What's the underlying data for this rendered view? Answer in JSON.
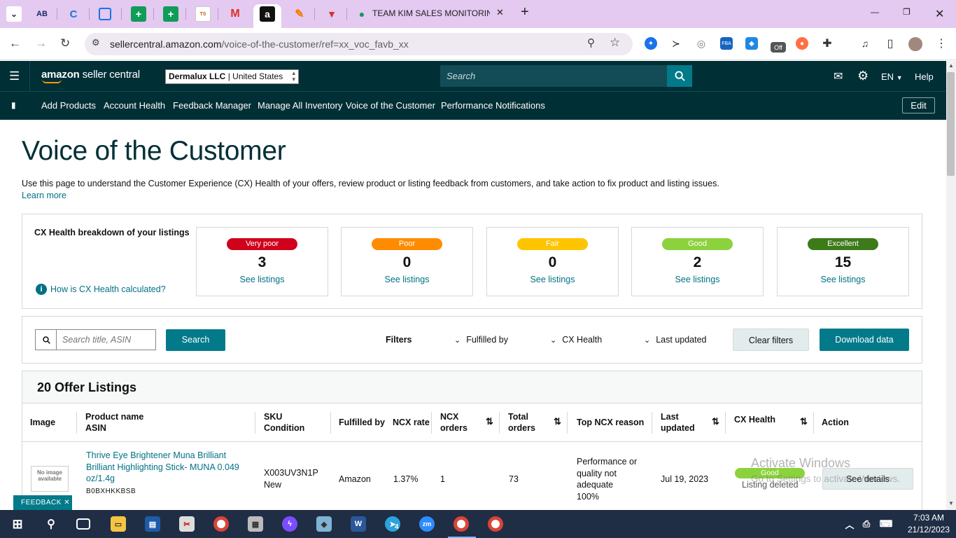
{
  "browser": {
    "tab_title": "TEAM KIM SALES MONITORING",
    "url_host": "sellercentral.amazon.com",
    "url_path": "/voice-of-the-customer/ref=xx_voc_favb_xx",
    "new_tab": "+",
    "minimize": "—",
    "close": "✕",
    "ext_off_badge": "Off"
  },
  "header": {
    "logo_brand": "amazon",
    "logo_product": "seller central",
    "account": "Dermalux LLC",
    "marketplace": "United States",
    "search_placeholder": "Search",
    "language": "EN",
    "help": "Help"
  },
  "nav": {
    "links": [
      "Add Products",
      "Account Health",
      "Feedback Manager",
      "Manage All Inventory",
      "Voice of the Customer",
      "Performance Notifications"
    ],
    "edit": "Edit"
  },
  "page": {
    "title": "Voice of the Customer",
    "intro": "Use this page to understand the Customer Experience (CX) Health of your offers, review product or listing feedback from customers, and take action to fix product and listing issues.",
    "learn_more": "Learn more"
  },
  "cx_health": {
    "heading": "CX Health breakdown of your listings",
    "how_link": "How is CX Health calculated?",
    "cards": [
      {
        "label": "Very poor",
        "count": "3",
        "link": "See listings",
        "color": "#d0021b",
        "text_color": "#ffffff"
      },
      {
        "label": "Poor",
        "count": "0",
        "link": "See listings",
        "color": "#ff8c00",
        "text_color": "#ffffff"
      },
      {
        "label": "Fair",
        "count": "0",
        "link": "See listings",
        "color": "#ffc400",
        "text_color": "#ffffff"
      },
      {
        "label": "Good",
        "count": "2",
        "link": "See listings",
        "color": "#8bd23c",
        "text_color": "#ffffff"
      },
      {
        "label": "Excellent",
        "count": "15",
        "link": "See listings",
        "color": "#3d7a1a",
        "text_color": "#ffffff"
      }
    ]
  },
  "filters": {
    "search_placeholder": "Search title, ASIN",
    "search_button": "Search",
    "label": "Filters",
    "fulfilled_by": "Fulfilled by",
    "cx_health": "CX Health",
    "last_updated": "Last updated",
    "clear": "Clear filters",
    "download": "Download data"
  },
  "listings": {
    "title": "20 Offer Listings",
    "columns": {
      "image": "Image",
      "product_name": "Product name",
      "asin": "ASIN",
      "sku": "SKU",
      "condition": "Condition",
      "fulfilled_by": "Fulfilled by",
      "ncx_rate": "NCX rate",
      "ncx_orders_1": "NCX",
      "ncx_orders_2": "orders",
      "total_orders_1": "Total",
      "total_orders_2": "orders",
      "top_ncx_reason": "Top NCX reason",
      "last_updated_1": "Last",
      "last_updated_2": "updated",
      "cx_health": "CX Health",
      "action": "Action"
    },
    "rows": [
      {
        "image_alt": "No image available",
        "product_name": "Thrive Eye Brightener Muna Brilliant Brilliant Highlighting Stick- MUNA 0.049 oz/1.4g",
        "asin": "B0BXHKKBSB",
        "sku": "X003UV3N1P",
        "condition": "New",
        "fulfilled_by": "Amazon",
        "ncx_rate": "1.37%",
        "ncx_orders": "1",
        "total_orders": "73",
        "top_ncx_reason": "Performance or quality not adequate",
        "top_ncx_pct": "100%",
        "last_updated": "Jul 19, 2023",
        "cx_health": "Good",
        "status": "Listing deleted",
        "action": "See details"
      }
    ]
  },
  "overlay": {
    "watermark_title": "Activate Windows",
    "watermark_sub": "Go to Settings to activate Windows.",
    "feedback": "FEEDBACK",
    "feedback_close": "✕"
  },
  "taskbar": {
    "time": "7:03 AM",
    "date": "21/12/2023",
    "telegram_badge": "4"
  }
}
